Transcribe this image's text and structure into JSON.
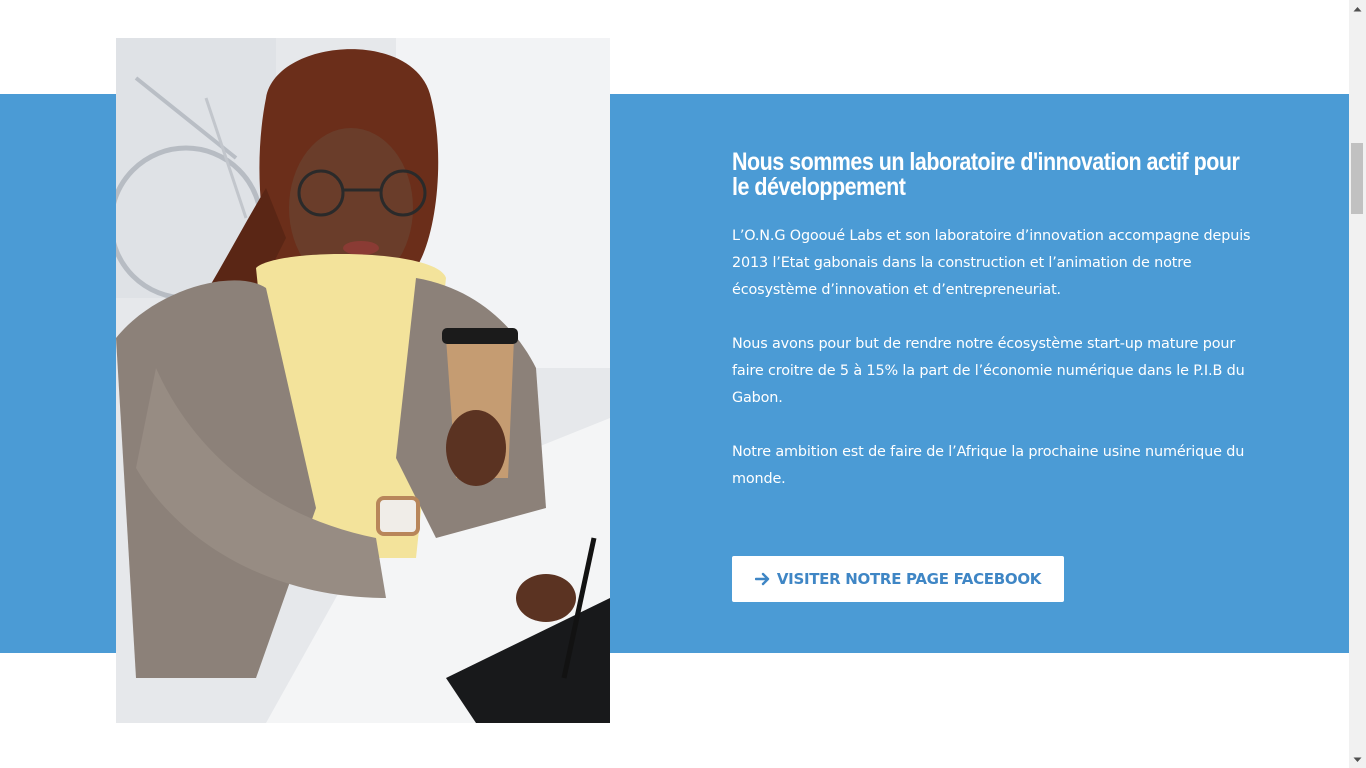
{
  "section": {
    "headline": "Nous sommes un laboratoire d'innovation actif pour le développement",
    "paragraphs": [
      "L’O.N.G Ogooué Labs et son laboratoire d’innovation accompagne depuis 2013 l’Etat gabonais dans la construction et l’animation de notre écosystème d’innovation et d’entrepreneuriat.",
      "Nous avons pour but de rendre notre écosystème start-up mature pour faire croitre de 5 à 15% la part de l’économie numérique dans le P.I.B du Gabon.",
      "Notre ambition est de faire de l’Afrique la prochaine usine numérique du monde."
    ],
    "cta_label": "VISITER NOTRE PAGE FACEBOOK",
    "cta_icon": "arrow-right-icon"
  },
  "colors": {
    "band": "#4b9bd5",
    "cta_text": "#3f86c5",
    "background": "#ffffff"
  },
  "scrollbar": {
    "position_fraction": 0.19
  }
}
